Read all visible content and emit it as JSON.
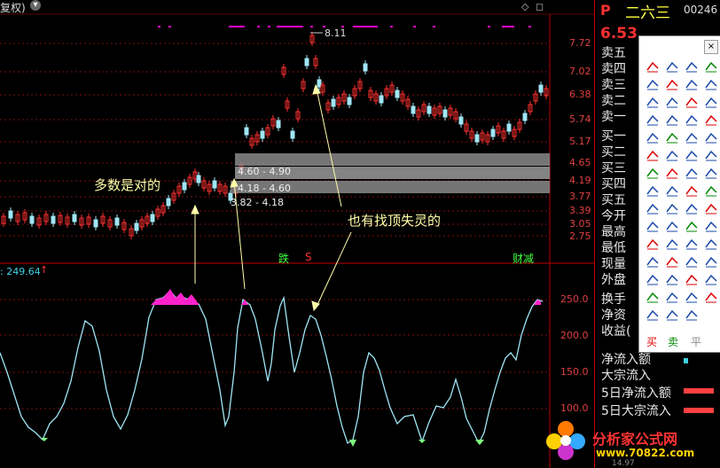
{
  "topbar": {
    "title": "复权)",
    "dropdown_glyph": "▾",
    "diamond_glyph": "◇",
    "close_glyph": "◻"
  },
  "quote": {
    "p_label": "P",
    "stock_name": "二六三",
    "code": "00246",
    "price": "6.53",
    "rows": [
      "卖五",
      "卖四",
      "卖三",
      "卖二",
      "卖一",
      "买一",
      "买二",
      "买三",
      "买四",
      "买五",
      "今开",
      "最高",
      "最低",
      "现量",
      "外盘",
      "换手",
      "净资",
      "收益(",
      "净流入额",
      "大宗流入",
      "5日净流入额",
      "5日大宗流入"
    ]
  },
  "toolbox": {
    "close_label": "×",
    "buy_label": "买",
    "sell_label": "卖",
    "flat_label": "平"
  },
  "chart": {
    "price_axis": [
      "7.72",
      "7.02",
      "6.38",
      "5.74",
      "5.17",
      "4.65",
      "4.19",
      "3.77",
      "3.39",
      "3.05",
      "2.75"
    ],
    "indicator_axis": [
      "250.0",
      "200.0",
      "150.0",
      "100.0"
    ],
    "indicator_value": ": 249.64",
    "high_label": "8.11",
    "bands": [
      "4.60 - 4.90",
      "4.18 - 4.60",
      "3.82 - 4.18"
    ],
    "annotation_left": "多数是对的",
    "annotation_right": "也有找顶失灵的",
    "marker_down": "跌",
    "marker_s": "S",
    "marker_reduce": "财减"
  },
  "watermark": {
    "brand": "分析家公式网",
    "url": "www.70822.com",
    "bottom_code": "14.97"
  }
}
